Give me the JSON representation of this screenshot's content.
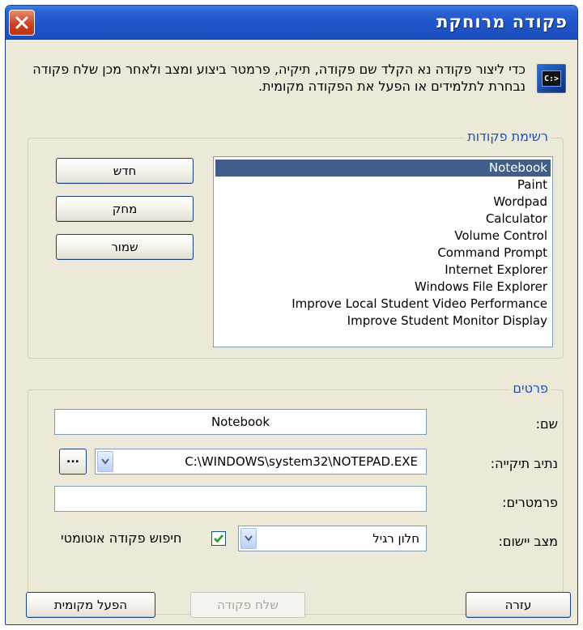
{
  "window": {
    "title": "פקודה מרוחקת",
    "close_symbol": "×"
  },
  "header": {
    "icon": "command-prompt-icon",
    "icon_text": "C:>",
    "text": "כדי ליצור פקודה נא הקלד שם פקודה, תיקיה, פרמטר ביצוע ומצב ולאחר מכן שלח פקודה נבחרת לתלמידים או הפעל את הפקודה מקומית."
  },
  "commands_group": {
    "label": "רשימת פקודות",
    "items": [
      "Notebook",
      "Paint",
      "Wordpad",
      "Calculator",
      "Volume Control",
      "Command Prompt",
      "Internet Explorer",
      "Windows File Explorer",
      "Improve Local Student Video Performance",
      "Improve Student Monitor Display"
    ],
    "selected_index": 0,
    "buttons": {
      "new": "חדש",
      "delete": "מחק",
      "save": "שמור"
    }
  },
  "details_group": {
    "label": "פרטים",
    "name_label": "שם:",
    "name_value": "Notebook",
    "path_label": "נתיב תיקייה:",
    "path_value": "C:\\WINDOWS\\system32\\NOTEPAD.EXE",
    "browse_label": "...",
    "params_label": "פרמטרים:",
    "params_value": "",
    "mode_label": "מצב יישום:",
    "mode_value": "חלון רגיל",
    "auto_search_label": "חיפוש פקודה אוטומטי",
    "auto_search_checked": true
  },
  "footer": {
    "help": "עזרה",
    "send": "שלח פקודה",
    "run_local": "הפעל מקומית"
  },
  "colors": {
    "titlebar": "#1f55c8",
    "window_bg": "#ece9d8",
    "selection": "#3f5f8a",
    "group_label": "#1f4fc0"
  }
}
